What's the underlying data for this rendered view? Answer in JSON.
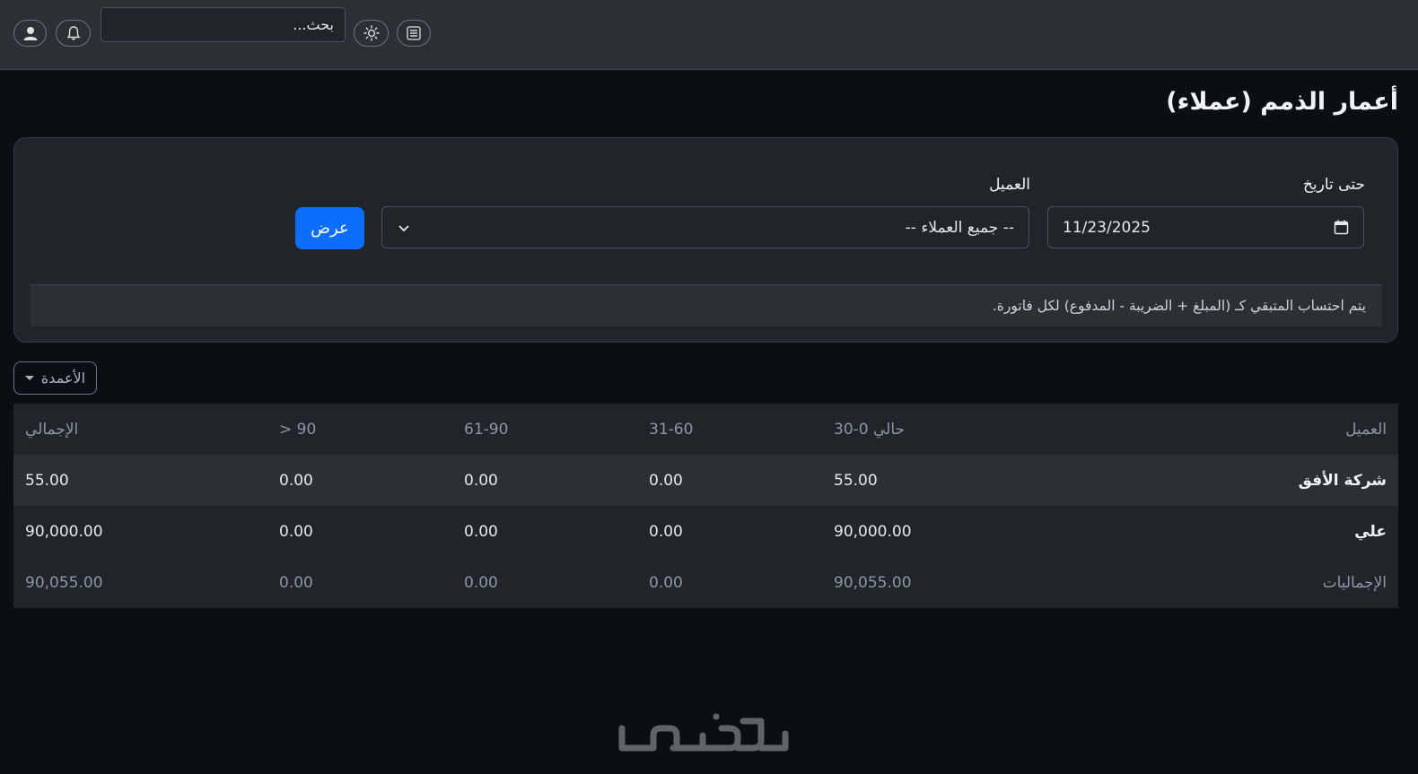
{
  "topbar": {
    "search_placeholder": "بحث...",
    "icons": [
      "user-icon",
      "bell-icon",
      "sun-icon",
      "menu-icon"
    ]
  },
  "page": {
    "title": "أعمار الذمم (عملاء)"
  },
  "filters": {
    "date_label": "حتى تاريخ",
    "date_value": "11/23/2025",
    "customer_label": "العميل",
    "customer_value": "-- جميع العملاء --",
    "submit_label": "عرض",
    "note": "يتم احتساب المتبقي كـ (المبلغ + الضريبة - المدفوع) لكل فاتورة."
  },
  "columns_button": {
    "label": "الأعمدة"
  },
  "table": {
    "headers": [
      "العميل",
      "حالي 0-30",
      "31-60",
      "61-90",
      "> 90",
      "الإجمالي"
    ],
    "rows": [
      {
        "customer": "شركة الأفق",
        "current": "55.00",
        "d31_60": "0.00",
        "d61_90": "0.00",
        "d90": "0.00",
        "total": "55.00"
      },
      {
        "customer": "علي",
        "current": "90,000.00",
        "d31_60": "0.00",
        "d61_90": "0.00",
        "d90": "0.00",
        "total": "90,000.00"
      }
    ],
    "totals": {
      "label": "الإجماليات",
      "current": "90,055.00",
      "d31_60": "0.00",
      "d61_90": "0.00",
      "d90": "0.00",
      "total": "90,055.00"
    }
  },
  "footer": {
    "logo": "خمسات"
  },
  "colors": {
    "primary": "#0d6efd",
    "background": "#0b0f14",
    "surface": "#212529",
    "topbar": "#2b3035"
  }
}
